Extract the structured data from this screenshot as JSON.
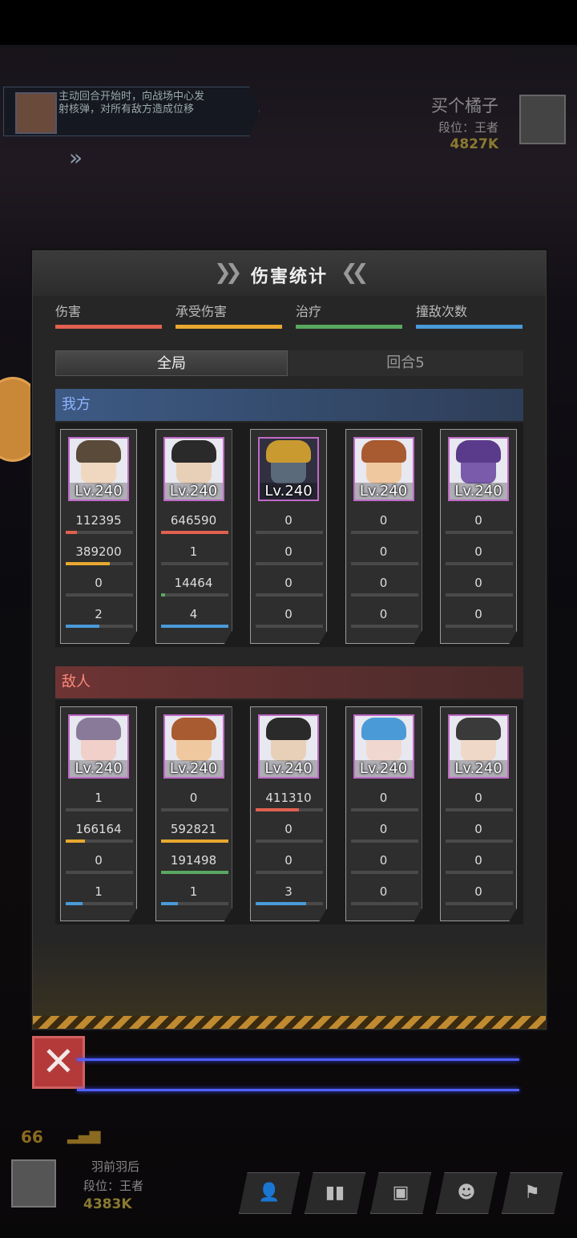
{
  "hud": {
    "skill_text": "主动回合开始时，向战场中心发射核弹，对所有敌方造成位移",
    "opponent": {
      "name": "买个橘子",
      "rank": "段位：王者",
      "power": "4827K"
    },
    "self": {
      "name": "羽前羽后",
      "rank": "段位：王者",
      "power": "4383K"
    },
    "fps": "66",
    "buttons": [
      {
        "icon": "friends-icon",
        "glyph": "👤"
      },
      {
        "icon": "stats-icon",
        "glyph": "▮▮"
      },
      {
        "icon": "bag-icon",
        "glyph": "▣"
      },
      {
        "icon": "emote-icon",
        "glyph": "☻"
      },
      {
        "icon": "flag-icon",
        "glyph": "⚑"
      }
    ]
  },
  "panel": {
    "title": "伤害统计",
    "legend": [
      {
        "label": "伤害",
        "color": "#e06050"
      },
      {
        "label": "承受伤害",
        "color": "#e8a830"
      },
      {
        "label": "治疗",
        "color": "#5aa860"
      },
      {
        "label": "撞敌次数",
        "color": "#4a9ad8"
      }
    ],
    "tabs": {
      "overall": "全局",
      "round": "回合5"
    },
    "ally_label": "我方",
    "enemy_label": "敌人",
    "close_label": "✕"
  },
  "allies": [
    {
      "level": "Lv.240",
      "damage": "112395",
      "damage_pct": 0.17,
      "taken": "389200",
      "taken_pct": 0.66,
      "heal": "0",
      "heal_pct": 0,
      "hits": "2",
      "hits_pct": 0.5,
      "palette": {
        "hair": "#5a4a3a",
        "face": "#f0d8c0",
        "bg": "#e8e8f0"
      }
    },
    {
      "level": "Lv.240",
      "damage": "646590",
      "damage_pct": 1.0,
      "taken": "1",
      "taken_pct": 0,
      "heal": "14464",
      "heal_pct": 0.07,
      "hits": "4",
      "hits_pct": 1.0,
      "palette": {
        "hair": "#2a2a2a",
        "face": "#e8d0b8",
        "bg": "#e8e8f0"
      }
    },
    {
      "level": "Lv.240",
      "damage": "0",
      "damage_pct": 0,
      "taken": "0",
      "taken_pct": 0,
      "heal": "0",
      "heal_pct": 0,
      "hits": "0",
      "hits_pct": 0,
      "palette": {
        "hair": "#c89a30",
        "face": "#5a6a7a",
        "bg": "#303040"
      }
    },
    {
      "level": "Lv.240",
      "damage": "0",
      "damage_pct": 0,
      "taken": "0",
      "taken_pct": 0,
      "heal": "0",
      "heal_pct": 0,
      "hits": "0",
      "hits_pct": 0,
      "palette": {
        "hair": "#a85a30",
        "face": "#f0c8a0",
        "bg": "#e8e8f0"
      }
    },
    {
      "level": "Lv.240",
      "damage": "0",
      "damage_pct": 0,
      "taken": "0",
      "taken_pct": 0,
      "heal": "0",
      "heal_pct": 0,
      "hits": "0",
      "hits_pct": 0,
      "palette": {
        "hair": "#5a3a8a",
        "face": "#7a5aaa",
        "bg": "#e8e8f0"
      }
    }
  ],
  "enemies": [
    {
      "level": "Lv.240",
      "damage": "1",
      "damage_pct": 0,
      "taken": "166164",
      "taken_pct": 0.28,
      "heal": "0",
      "heal_pct": 0,
      "hits": "1",
      "hits_pct": 0.25,
      "palette": {
        "hair": "#8a7a9a",
        "face": "#f0d0c8",
        "bg": "#e8e8f0"
      }
    },
    {
      "level": "Lv.240",
      "damage": "0",
      "damage_pct": 0,
      "taken": "592821",
      "taken_pct": 1.0,
      "heal": "191498",
      "heal_pct": 1.0,
      "hits": "1",
      "hits_pct": 0.25,
      "palette": {
        "hair": "#a85a30",
        "face": "#f0c8a0",
        "bg": "#e8e8f0"
      }
    },
    {
      "level": "Lv.240",
      "damage": "411310",
      "damage_pct": 0.64,
      "taken": "0",
      "taken_pct": 0,
      "heal": "0",
      "heal_pct": 0,
      "hits": "3",
      "hits_pct": 0.75,
      "palette": {
        "hair": "#2a2a2a",
        "face": "#e8d0b8",
        "bg": "#e8e8f0"
      }
    },
    {
      "level": "Lv.240",
      "damage": "0",
      "damage_pct": 0,
      "taken": "0",
      "taken_pct": 0,
      "heal": "0",
      "heal_pct": 0,
      "hits": "0",
      "hits_pct": 0,
      "palette": {
        "hair": "#4a9ad8",
        "face": "#f0d8d0",
        "bg": "#e8e8f0"
      }
    },
    {
      "level": "Lv.240",
      "damage": "0",
      "damage_pct": 0,
      "taken": "0",
      "taken_pct": 0,
      "heal": "0",
      "heal_pct": 0,
      "hits": "0",
      "hits_pct": 0,
      "palette": {
        "hair": "#3a3a3a",
        "face": "#f0d8c8",
        "bg": "#e8e8f0"
      }
    }
  ]
}
